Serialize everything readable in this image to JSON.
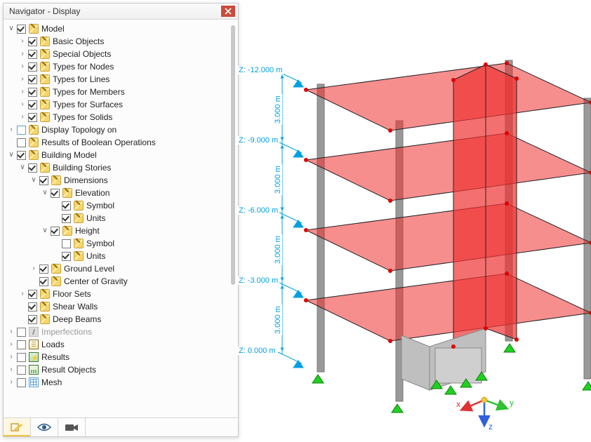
{
  "panel": {
    "title": "Navigator - Display"
  },
  "tree": {
    "model": "Model",
    "basic_objects": "Basic Objects",
    "special_objects": "Special Objects",
    "types_nodes": "Types for Nodes",
    "types_lines": "Types for Lines",
    "types_members": "Types for Members",
    "types_surfaces": "Types for Surfaces",
    "types_solids": "Types for Solids",
    "display_topology": "Display Topology on",
    "boolean_results": "Results of Boolean Operations",
    "building_model": "Building Model",
    "building_stories": "Building Stories",
    "dimensions": "Dimensions",
    "elevation": "Elevation",
    "elev_symbol": "Symbol",
    "elev_units": "Units",
    "height": "Height",
    "height_symbol": "Symbol",
    "height_units": "Units",
    "ground_level": "Ground Level",
    "center_of_gravity": "Center of Gravity",
    "floor_sets": "Floor Sets",
    "shear_walls": "Shear Walls",
    "deep_beams": "Deep Beams",
    "imperfections": "Imperfections",
    "loads": "Loads",
    "results": "Results",
    "result_objects": "Result Objects",
    "mesh": "Mesh"
  },
  "dims": {
    "z0": "Z: 0.000 m",
    "z3": "Z: -3.000 m",
    "z6": "Z: -6.000 m",
    "z9": "Z: -9.000 m",
    "z12": "Z: -12.000 m",
    "h": "3.000 m"
  },
  "axes": {
    "x": "x",
    "y": "y",
    "z": "z"
  }
}
